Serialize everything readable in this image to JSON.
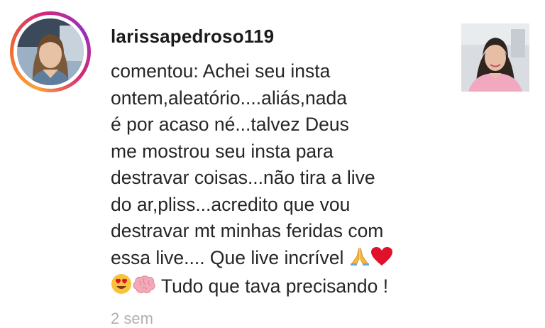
{
  "notification": {
    "username": "larissapedroso119",
    "comment_lines": [
      "comentou: Achei seu insta",
      "ontem,aleatório....aliás,nada",
      "é por acaso né...talvez Deus",
      "me mostrou seu insta para",
      "destravar coisas...não tira a live",
      "do ar,pliss...acredito que vou",
      "destravar mt minhas feridas com",
      "essa live.... Que live incrível"
    ],
    "last_line_text": " Tudo que tava precisando !",
    "timestamp": "2 sem",
    "avatar_icon": "user-avatar",
    "post_thumbnail_icon": "post-thumbnail",
    "emojis_line8": [
      "folded-hands-icon",
      "red-heart-icon"
    ],
    "emojis_line9": [
      "heart-eyes-emoji-icon",
      "brain-icon"
    ],
    "colors": {
      "story_ring": [
        "#f9a33a",
        "#d62976",
        "#962fbf"
      ],
      "text": "#262626",
      "timestamp": "#b0b0b0"
    }
  }
}
